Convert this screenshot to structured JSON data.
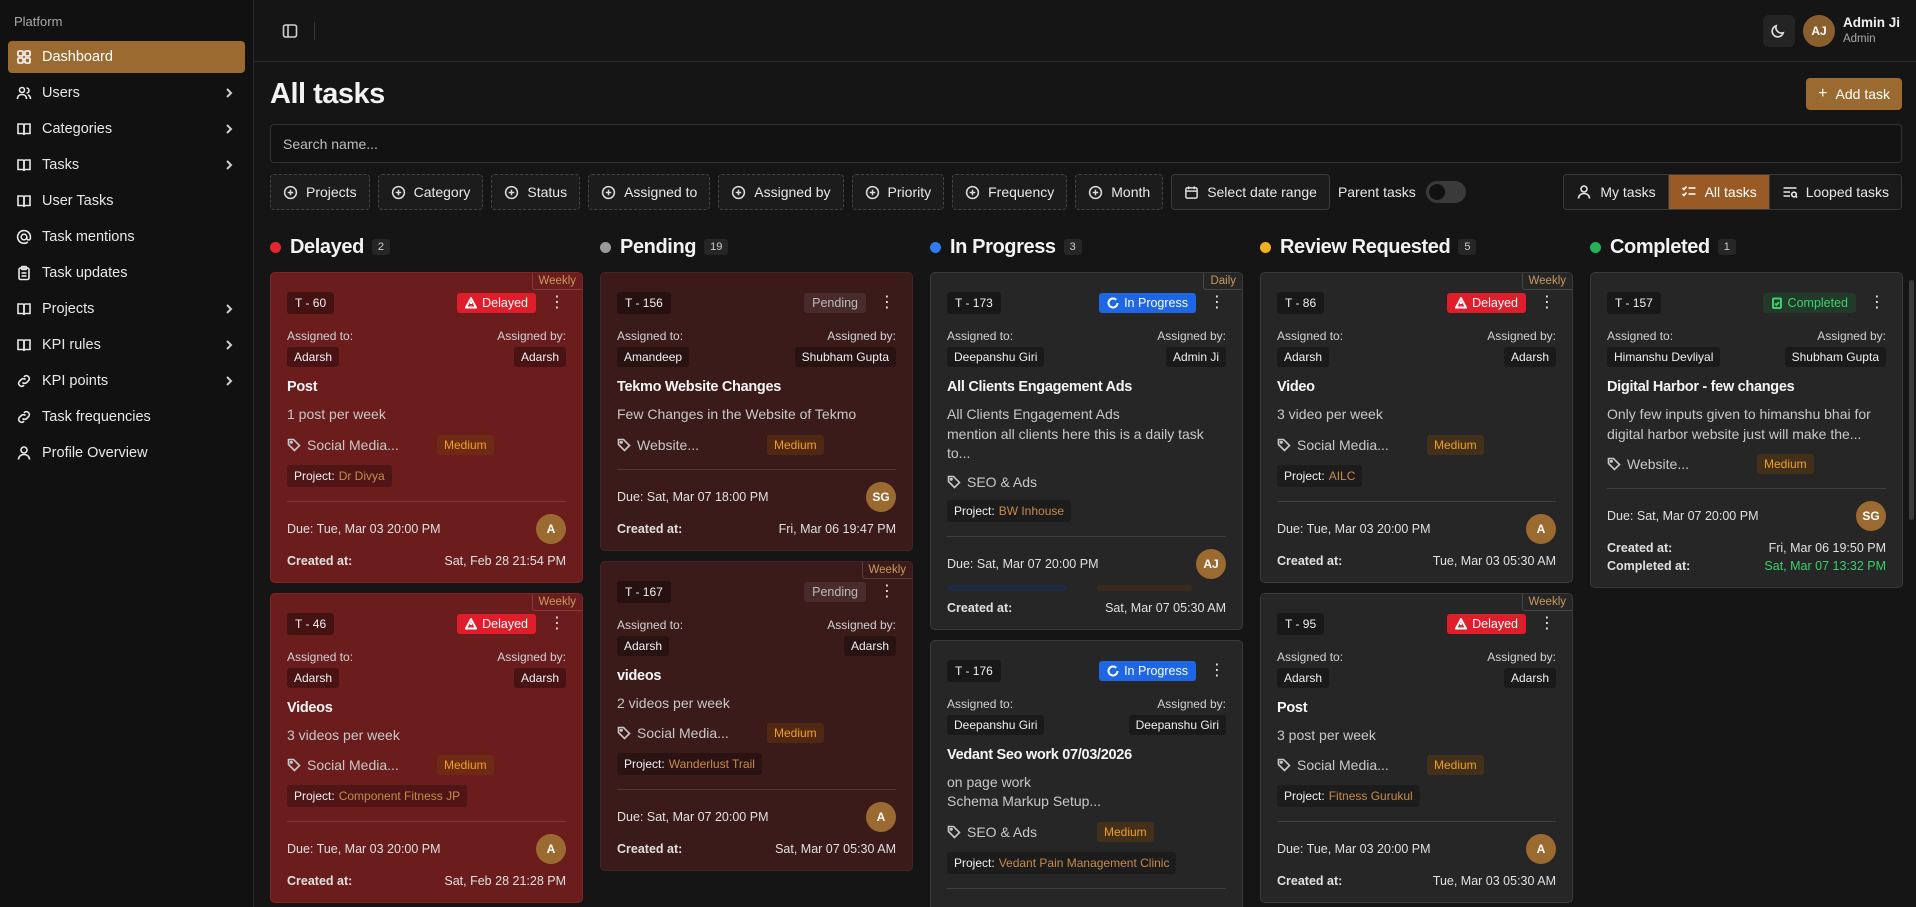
{
  "sidebar": {
    "heading": "Platform",
    "items": [
      {
        "label": "Dashboard",
        "icon": "dashboard-icon",
        "active": true,
        "chevron": false
      },
      {
        "label": "Users",
        "icon": "users-icon",
        "active": false,
        "chevron": true
      },
      {
        "label": "Categories",
        "icon": "book-icon",
        "active": false,
        "chevron": true
      },
      {
        "label": "Tasks",
        "icon": "book-icon",
        "active": false,
        "chevron": true
      },
      {
        "label": "User Tasks",
        "icon": "book-icon",
        "active": false,
        "chevron": false
      },
      {
        "label": "Task mentions",
        "icon": "at-icon",
        "active": false,
        "chevron": false
      },
      {
        "label": "Task updates",
        "icon": "clipboard-icon",
        "active": false,
        "chevron": false
      },
      {
        "label": "Projects",
        "icon": "book-icon",
        "active": false,
        "chevron": true
      },
      {
        "label": "KPI rules",
        "icon": "book-icon",
        "active": false,
        "chevron": true
      },
      {
        "label": "KPI points",
        "icon": "link-icon",
        "active": false,
        "chevron": true
      },
      {
        "label": "Task frequencies",
        "icon": "link-icon",
        "active": false,
        "chevron": false
      },
      {
        "label": "Profile Overview",
        "icon": "user-icon",
        "active": false,
        "chevron": false
      }
    ]
  },
  "topbar": {
    "avatar_initials": "AJ",
    "user_name": "Admin Ji",
    "user_role": "Admin"
  },
  "page": {
    "title": "All tasks",
    "add_label": "Add task",
    "search_placeholder": "Search name..."
  },
  "filters": [
    "Projects",
    "Category",
    "Status",
    "Assigned to",
    "Assigned by",
    "Priority",
    "Frequency",
    "Month"
  ],
  "date_range_label": "Select date range",
  "parent_tasks_label": "Parent tasks",
  "views": [
    {
      "label": "My tasks",
      "active": false
    },
    {
      "label": "All tasks",
      "active": true
    },
    {
      "label": "Looped tasks",
      "active": false
    }
  ],
  "labels": {
    "assigned_to": "Assigned to:",
    "assigned_by": "Assigned by:",
    "project": "Project:",
    "due_prefix": "Due:",
    "created_at": "Created at:",
    "completed_at": "Completed at:"
  },
  "columns": [
    {
      "title": "Delayed",
      "count": "2",
      "dot_color": "#e5262f",
      "cards": [
        {
          "style": "delayed",
          "freq": "Weekly",
          "id": "T - 60",
          "status": "Delayed",
          "status_style": "delayed",
          "assigned_to": "Adarsh",
          "assigned_by": "Adarsh",
          "title": "Post",
          "desc": "1 post per week",
          "tag": "Social Media...",
          "priority": "Medium",
          "project": "Dr Divya",
          "due": "Tue, Mar 03 20:00 PM",
          "avatar": "A",
          "created": "Sat, Feb 28 21:54 PM"
        },
        {
          "style": "delayed",
          "freq": "Weekly",
          "id": "T - 46",
          "status": "Delayed",
          "status_style": "delayed",
          "assigned_to": "Adarsh",
          "assigned_by": "Adarsh",
          "title": "Videos",
          "desc": "3 videos per week",
          "tag": "Social Media...",
          "priority": "Medium",
          "project": "Component Fitness JP",
          "due": "Tue, Mar 03 20:00 PM",
          "avatar": "A",
          "created": "Sat, Feb 28 21:28 PM"
        }
      ]
    },
    {
      "title": "Pending",
      "count": "19",
      "dot_color": "#9a9a9a",
      "cards": [
        {
          "style": "pending",
          "freq": "",
          "id": "T - 156",
          "status": "Pending",
          "status_style": "pending",
          "assigned_to": "Amandeep",
          "assigned_by": "Shubham Gupta",
          "title": "Tekmo Website Changes",
          "desc": "Few Changes in the Website of Tekmo",
          "tag": "Website...",
          "priority": "Medium",
          "project": "",
          "due": "Sat, Mar 07 18:00 PM",
          "avatar": "SG",
          "created": "Fri, Mar 06 19:47 PM"
        },
        {
          "style": "pending",
          "freq": "Weekly",
          "id": "T - 167",
          "status": "Pending",
          "status_style": "pending",
          "assigned_to": "Adarsh",
          "assigned_by": "Adarsh",
          "title": "videos",
          "desc": "2 videos per week",
          "tag": "Social Media...",
          "priority": "Medium",
          "project": "Wanderlust Trail",
          "due": "Sat, Mar 07 20:00 PM",
          "avatar": "A",
          "created": "Sat, Mar 07 05:30 AM"
        }
      ]
    },
    {
      "title": "In Progress",
      "count": "3",
      "dot_color": "#2f7bf0",
      "cards": [
        {
          "style": "normal",
          "freq": "Daily",
          "id": "T - 173",
          "status": "In Progress",
          "status_style": "progress",
          "assigned_to": "Deepanshu Giri",
          "assigned_by": "Admin Ji",
          "title": "All Clients Engagement Ads",
          "desc": "All Clients Engagement Ads\nmention all clients here this is a daily task to...",
          "tag": "SEO & Ads",
          "priority": "",
          "project": "BW Inhouse",
          "due": "Sat, Mar 07 20:00 PM",
          "avatar": "AJ",
          "created": "Sat, Mar 07 05:30 AM"
        },
        {
          "style": "normal",
          "freq": "",
          "id": "T - 176",
          "status": "In Progress",
          "status_style": "progress",
          "assigned_to": "Deepanshu Giri",
          "assigned_by": "Deepanshu Giri",
          "title": "Vedant Seo work 07/03/2026",
          "desc": "on page work\nSchema Markup Setup...",
          "tag": "SEO & Ads",
          "priority": "Medium",
          "project": "Vedant Pain Management Clinic",
          "due": "",
          "avatar": "",
          "created": ""
        }
      ]
    },
    {
      "title": "Review Requested",
      "count": "5",
      "dot_color": "#f0b21a",
      "cards": [
        {
          "style": "normal",
          "freq": "Weekly",
          "id": "T - 86",
          "status": "Delayed",
          "status_style": "delayed",
          "assigned_to": "Adarsh",
          "assigned_by": "Adarsh",
          "title": "Video",
          "desc": "3 video per week",
          "tag": "Social Media...",
          "priority": "Medium",
          "project": "AILC",
          "due": "Tue, Mar 03 20:00 PM",
          "avatar": "A",
          "created": "Tue, Mar 03 05:30 AM"
        },
        {
          "style": "normal",
          "freq": "Weekly",
          "id": "T - 95",
          "status": "Delayed",
          "status_style": "delayed",
          "assigned_to": "Adarsh",
          "assigned_by": "Adarsh",
          "title": "Post",
          "desc": "3 post per week",
          "tag": "Social Media...",
          "priority": "Medium",
          "project": "Fitness Gurukul",
          "due": "Tue, Mar 03 20:00 PM",
          "avatar": "A",
          "created": "Tue, Mar 03 05:30 AM"
        }
      ]
    },
    {
      "title": "Completed",
      "count": "1",
      "dot_color": "#23b455",
      "cards": [
        {
          "style": "normal",
          "freq": "",
          "id": "T - 157",
          "status": "Completed",
          "status_style": "completed",
          "assigned_to": "Himanshu Devliyal",
          "assigned_by": "Shubham Gupta",
          "title": "Digital Harbor - few changes",
          "desc": "Only few inputs given to himanshu bhai for digital harbor website just will make the...",
          "tag": "Website...",
          "priority": "Medium",
          "project": "",
          "due": "Sat, Mar 07 20:00 PM",
          "avatar": "SG",
          "created": "Fri, Mar 06 19:50 PM",
          "completed": "Sat, Mar 07 13:32 PM"
        }
      ]
    }
  ]
}
